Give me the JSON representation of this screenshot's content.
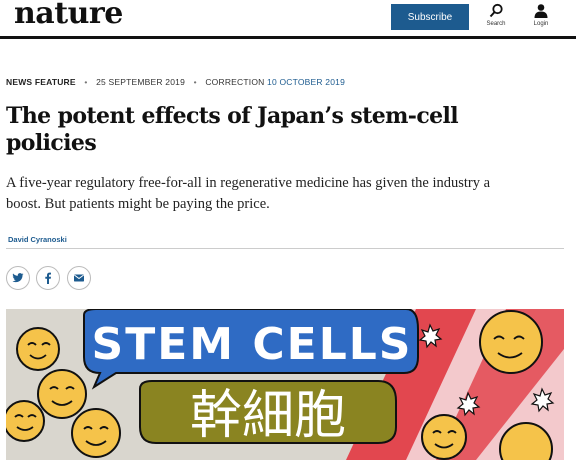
{
  "header": {
    "logo_text": "nature",
    "subscribe_label": "Subscribe",
    "search_label": "Search",
    "login_label": "Login"
  },
  "article": {
    "type": "NEWS FEATURE",
    "date": "25 SEPTEMBER 2019",
    "correction_label": "CORRECTION",
    "correction_date": "10 OCTOBER 2019",
    "title": "The potent effects of Japan’s stem-cell policies",
    "standfirst": "A five-year regulatory free-for-all in regenerative medicine has given the industry a boost. But patients might be paying the price.",
    "author": "David Cyranoski"
  },
  "share": {
    "icons": [
      "twitter-icon",
      "facebook-icon",
      "email-icon"
    ]
  },
  "hero": {
    "text_en": "STEM CELLS",
    "text_jp": "幹細胞"
  },
  "colors": {
    "brand_blue": "#1d5b8f",
    "hero_blue": "#2f6bc4",
    "hero_olive": "#8a8421",
    "hero_pink": "#f3c9cc",
    "hero_red": "#e2474f",
    "cell_yellow": "#f5c34a"
  }
}
